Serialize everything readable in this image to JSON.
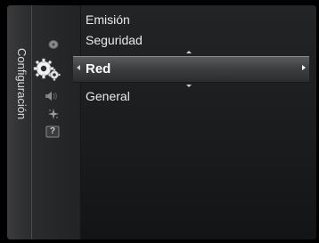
{
  "sidebar": {
    "label": "Configuración",
    "categories": [
      {
        "icon": "satellite-dish-icon"
      },
      {
        "icon": "gear-settings-icon",
        "selected": true
      },
      {
        "icon": "speaker-icon"
      },
      {
        "icon": "sparkle-icon"
      },
      {
        "icon": "help-icon",
        "glyph": "?"
      }
    ]
  },
  "menu": {
    "items": [
      "Emisión",
      "Seguridad",
      "Red",
      "General"
    ],
    "selected_index": 2
  },
  "colors": {
    "background": "#000000",
    "panel": "#1f2022",
    "highlight": "#4a4b4d",
    "text": "#eaeaea",
    "selected_text": "#ffffff"
  }
}
